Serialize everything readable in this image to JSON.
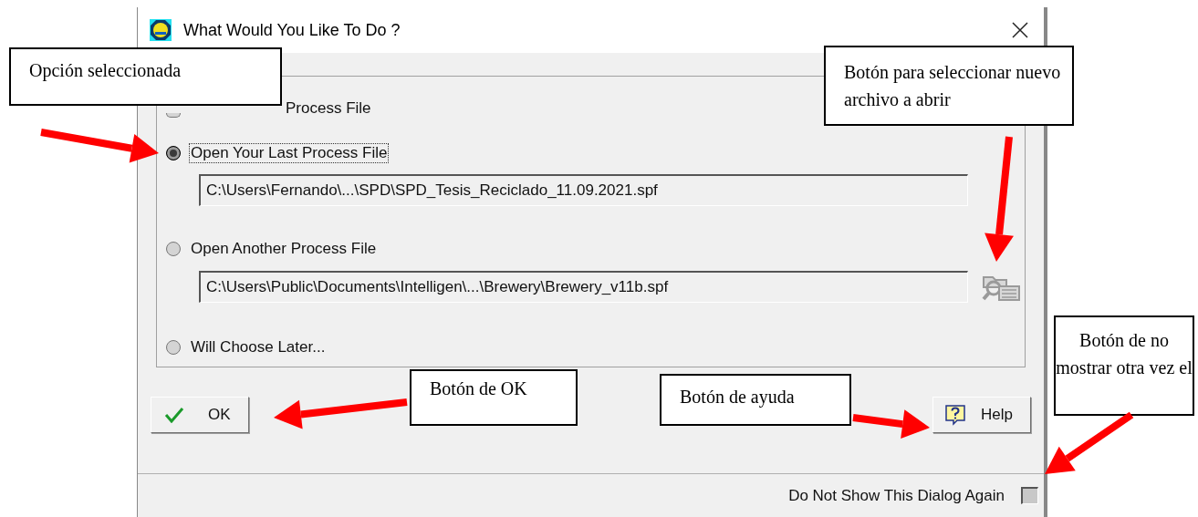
{
  "dialog": {
    "title": "What Would You Like To Do ?",
    "options": [
      {
        "kind": "partial",
        "label": "Process File",
        "selected": false
      },
      {
        "kind": "path",
        "label": "Open Your Last Process File",
        "selected": true,
        "path": "C:\\Users\\Fernando\\...\\SPD\\SPD_Tesis_Reciclado_11.09.2021.spf"
      },
      {
        "kind": "browse",
        "label": "Open Another Process File",
        "selected": false,
        "path": "C:\\Users\\Public\\Documents\\Intelligen\\...\\Brewery\\Brewery_v11b.spf"
      },
      {
        "kind": "plain",
        "label": "Will Choose Later...",
        "selected": false
      }
    ],
    "ok_button": "OK",
    "help_button": "Help",
    "dont_show": {
      "label": "Do Not Show This Dialog Again",
      "checked": false
    }
  },
  "callouts": [
    {
      "text": "Opción seleccionada"
    },
    {
      "text": "Botón para seleccionar nuevo archivo a abrir"
    },
    {
      "text": "Botón de OK"
    },
    {
      "text": "Botón de ayuda"
    },
    {
      "text": "Botón de no mostrar otra vez el"
    }
  ]
}
